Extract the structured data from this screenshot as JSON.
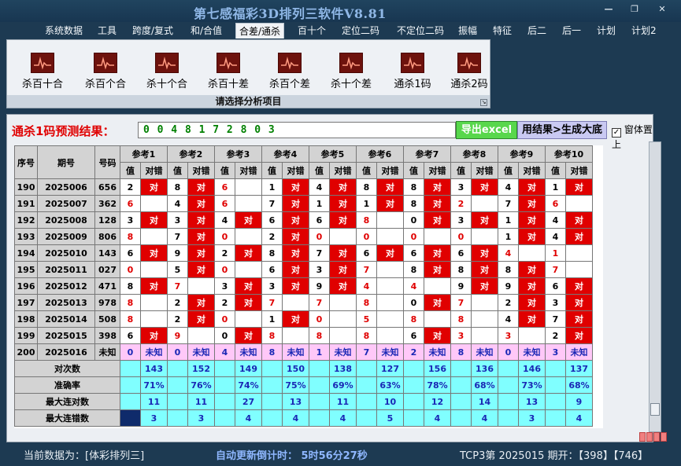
{
  "window": {
    "title": "第七感福彩3D排列三软件V8.81"
  },
  "menu": [
    "系统数据",
    "工具",
    "跨度/复式",
    "和/合值",
    "合差/通杀",
    "百十个",
    "定位二码",
    "不定位二码",
    "振幅",
    "特征",
    "后二",
    "后一",
    "计划",
    "计划2"
  ],
  "menu_active": 4,
  "tools": [
    "杀百十合",
    "杀百个合",
    "杀十个合",
    "杀百十差",
    "杀百个差",
    "杀十个差",
    "通杀1码",
    "通杀2码"
  ],
  "panel_caption": "请选择分析项目",
  "prediction": {
    "label": "通杀1码预测结果：",
    "value": "0 0 4 8 1 7 2 8 0 3"
  },
  "buttons": {
    "export": "导出excel",
    "result": "用结果>生成大底"
  },
  "topmost_label": "窗体置上",
  "table": {
    "headers": {
      "seq": "序号",
      "period": "期号",
      "code": "号码",
      "val": "值",
      "mark": "对错"
    },
    "refs": [
      "参考1",
      "参考2",
      "参考3",
      "参考4",
      "参考5",
      "参考6",
      "参考7",
      "参考8",
      "参考9",
      "参考10"
    ],
    "rows": [
      {
        "seq": "190",
        "period": "2025006",
        "code": "656",
        "cells": [
          [
            "2",
            1
          ],
          [
            "8",
            1
          ],
          [
            "6",
            0
          ],
          [
            "1",
            1
          ],
          [
            "4",
            1
          ],
          [
            "8",
            1
          ],
          [
            "8",
            1
          ],
          [
            "3",
            1
          ],
          [
            "4",
            1
          ],
          [
            "1",
            1
          ]
        ],
        "hl": [
          0,
          0,
          1,
          0,
          0,
          0,
          0,
          0,
          0,
          0
        ]
      },
      {
        "seq": "191",
        "period": "2025007",
        "code": "362",
        "cells": [
          [
            "6",
            0
          ],
          [
            "4",
            1
          ],
          [
            "6",
            0
          ],
          [
            "7",
            1
          ],
          [
            "1",
            1
          ],
          [
            "1",
            1
          ],
          [
            "8",
            1
          ],
          [
            "2",
            0
          ],
          [
            "7",
            1
          ],
          [
            "6",
            0
          ]
        ],
        "hl": [
          1,
          0,
          1,
          0,
          0,
          0,
          0,
          1,
          0,
          1
        ]
      },
      {
        "seq": "192",
        "period": "2025008",
        "code": "128",
        "cells": [
          [
            "3",
            1
          ],
          [
            "3",
            1
          ],
          [
            "4",
            1
          ],
          [
            "6",
            1
          ],
          [
            "6",
            1
          ],
          [
            "8",
            0
          ],
          [
            "0",
            1
          ],
          [
            "3",
            1
          ],
          [
            "1",
            1
          ],
          [
            "4",
            1
          ]
        ],
        "hl": [
          0,
          0,
          0,
          0,
          0,
          1,
          0,
          0,
          0,
          0
        ]
      },
      {
        "seq": "193",
        "period": "2025009",
        "code": "806",
        "cells": [
          [
            "8",
            0
          ],
          [
            "7",
            1
          ],
          [
            "0",
            0
          ],
          [
            "2",
            1
          ],
          [
            "0",
            0
          ],
          [
            "0",
            0
          ],
          [
            "0",
            0
          ],
          [
            "0",
            0
          ],
          [
            "1",
            1
          ],
          [
            "4",
            1
          ]
        ],
        "hl": [
          1,
          0,
          1,
          0,
          1,
          1,
          1,
          1,
          0,
          0
        ]
      },
      {
        "seq": "194",
        "period": "2025010",
        "code": "143",
        "cells": [
          [
            "6",
            1
          ],
          [
            "9",
            1
          ],
          [
            "2",
            1
          ],
          [
            "8",
            1
          ],
          [
            "7",
            1
          ],
          [
            "6",
            1
          ],
          [
            "6",
            1
          ],
          [
            "6",
            1
          ],
          [
            "4",
            0
          ],
          [
            "1",
            0
          ]
        ],
        "hl": [
          0,
          0,
          0,
          0,
          0,
          0,
          0,
          0,
          1,
          1
        ]
      },
      {
        "seq": "195",
        "period": "2025011",
        "code": "027",
        "cells": [
          [
            "0",
            0
          ],
          [
            "5",
            1
          ],
          [
            "0",
            0
          ],
          [
            "6",
            1
          ],
          [
            "3",
            1
          ],
          [
            "7",
            0
          ],
          [
            "8",
            1
          ],
          [
            "8",
            1
          ],
          [
            "8",
            1
          ],
          [
            "7",
            0
          ]
        ],
        "hl": [
          1,
          0,
          1,
          0,
          0,
          1,
          0,
          0,
          0,
          1
        ]
      },
      {
        "seq": "196",
        "period": "2025012",
        "code": "471",
        "cells": [
          [
            "8",
            1
          ],
          [
            "7",
            0
          ],
          [
            "3",
            1
          ],
          [
            "3",
            1
          ],
          [
            "9",
            1
          ],
          [
            "4",
            0
          ],
          [
            "4",
            0
          ],
          [
            "9",
            1
          ],
          [
            "9",
            1
          ],
          [
            "6",
            1
          ]
        ],
        "hl": [
          0,
          1,
          0,
          0,
          0,
          1,
          1,
          0,
          0,
          0
        ]
      },
      {
        "seq": "197",
        "period": "2025013",
        "code": "978",
        "cells": [
          [
            "8",
            0
          ],
          [
            "2",
            1
          ],
          [
            "2",
            1
          ],
          [
            "7",
            0
          ],
          [
            "7",
            0
          ],
          [
            "8",
            0
          ],
          [
            "0",
            1
          ],
          [
            "7",
            0
          ],
          [
            "2",
            1
          ],
          [
            "3",
            1
          ]
        ],
        "hl": [
          1,
          0,
          0,
          1,
          1,
          1,
          0,
          1,
          0,
          0
        ]
      },
      {
        "seq": "198",
        "period": "2025014",
        "code": "508",
        "cells": [
          [
            "8",
            0
          ],
          [
            "2",
            1
          ],
          [
            "0",
            0
          ],
          [
            "1",
            1
          ],
          [
            "0",
            0
          ],
          [
            "5",
            0
          ],
          [
            "8",
            0
          ],
          [
            "8",
            0
          ],
          [
            "4",
            1
          ],
          [
            "7",
            1
          ]
        ],
        "hl": [
          1,
          0,
          1,
          0,
          1,
          1,
          1,
          1,
          0,
          0
        ]
      },
      {
        "seq": "199",
        "period": "2025015",
        "code": "398",
        "cells": [
          [
            "6",
            1
          ],
          [
            "9",
            0
          ],
          [
            "0",
            1
          ],
          [
            "8",
            0
          ],
          [
            "8",
            0
          ],
          [
            "8",
            0
          ],
          [
            "6",
            1
          ],
          [
            "3",
            0
          ],
          [
            "3",
            0
          ],
          [
            "2",
            1
          ]
        ],
        "hl": [
          0,
          1,
          0,
          1,
          1,
          1,
          0,
          1,
          1,
          0
        ]
      }
    ],
    "mark_text": "对",
    "pred_row": {
      "seq": "200",
      "period": "2025016",
      "code": "未知",
      "vals": [
        "0",
        "0",
        "4",
        "8",
        "1",
        "7",
        "2",
        "8",
        "0",
        "3"
      ],
      "unknown": "未知"
    },
    "stats": [
      {
        "label": "对次数",
        "values": [
          "143",
          "152",
          "149",
          "150",
          "138",
          "127",
          "156",
          "136",
          "146",
          "137"
        ]
      },
      {
        "label": "准确率",
        "values": [
          "71%",
          "76%",
          "74%",
          "75%",
          "69%",
          "63%",
          "78%",
          "68%",
          "73%",
          "68%"
        ]
      },
      {
        "label": "最大连对数",
        "values": [
          "11",
          "11",
          "27",
          "13",
          "11",
          "10",
          "12",
          "14",
          "13",
          "9"
        ]
      },
      {
        "label": "最大连错数",
        "values": [
          "3",
          "3",
          "4",
          "4",
          "4",
          "5",
          "4",
          "4",
          "3",
          "4"
        ]
      }
    ]
  },
  "status": {
    "current_data": "当前数据为：[体彩排列三]",
    "countdown": "自动更新倒计时： 5时56分27秒",
    "tcp": "TCP3第 2025015 期开：【398】【746】"
  }
}
